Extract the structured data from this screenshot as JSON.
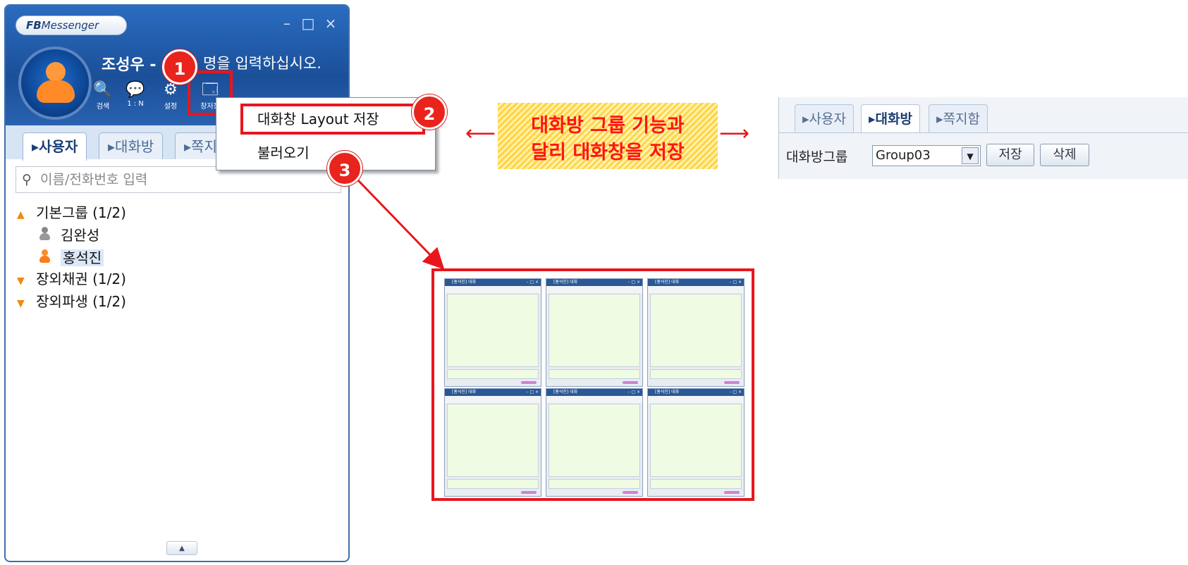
{
  "messenger": {
    "logo_bold": "FB",
    "logo_rest": "Messenger",
    "window_controls": {
      "minimize": "–",
      "maximize": "□",
      "close": "×"
    },
    "username": "조성우 -",
    "status_message": "명을 입력하십시오.",
    "toolbar": [
      {
        "icon": "search-icon",
        "glyph": "🔍",
        "label": "검색"
      },
      {
        "icon": "chat-icon",
        "glyph": "💬",
        "label": "1 : N"
      },
      {
        "icon": "gear-icon",
        "glyph": "⚙",
        "label": "설정"
      },
      {
        "icon": "window-icon",
        "glyph": "🗔",
        "label": "창저장"
      }
    ],
    "tabs": [
      {
        "label": "사용자",
        "active": true
      },
      {
        "label": "대화방",
        "active": false
      },
      {
        "label": "쪽지",
        "active": false
      }
    ],
    "search_placeholder": "이름/전화번호 입력",
    "groups": [
      {
        "name": "기본그룹 (1/2)",
        "expanded": true,
        "members": [
          {
            "name": "김완성",
            "online": false
          },
          {
            "name": "홍석진",
            "online": true
          }
        ]
      },
      {
        "name": "장외채권 (1/2)",
        "expanded": false
      },
      {
        "name": "장외파생 (1/2)",
        "expanded": false
      }
    ],
    "collapse_button": "▲"
  },
  "context_menu": {
    "save_layout": "대화창 Layout 저장",
    "load": "불러오기"
  },
  "steps": [
    "1",
    "2",
    "3"
  ],
  "annotation": {
    "line1": "대화방 그룹 기능과",
    "line2": "달리 대화창을 저장"
  },
  "room_toolbar": {
    "tabs": [
      "사용자",
      "대화방",
      "쪽지함"
    ],
    "active_tab": "대화방",
    "group_label": "대화방그룹",
    "selected_group": "Group03",
    "save_button": "저장",
    "delete_button": "삭제"
  },
  "preview_windows": [
    {
      "title": "[홍석진] 대화"
    },
    {
      "title": "[홍석진] 대화"
    },
    {
      "title": "[홍석진] 대화"
    },
    {
      "title": "[홍석진] 대화"
    },
    {
      "title": "[홍석진] 대화"
    },
    {
      "title": "[홍석진] 대화"
    }
  ],
  "colors": {
    "accent_red": "#e8161c",
    "brand_blue": "#1b4f98",
    "online_orange": "#ff8a28"
  }
}
